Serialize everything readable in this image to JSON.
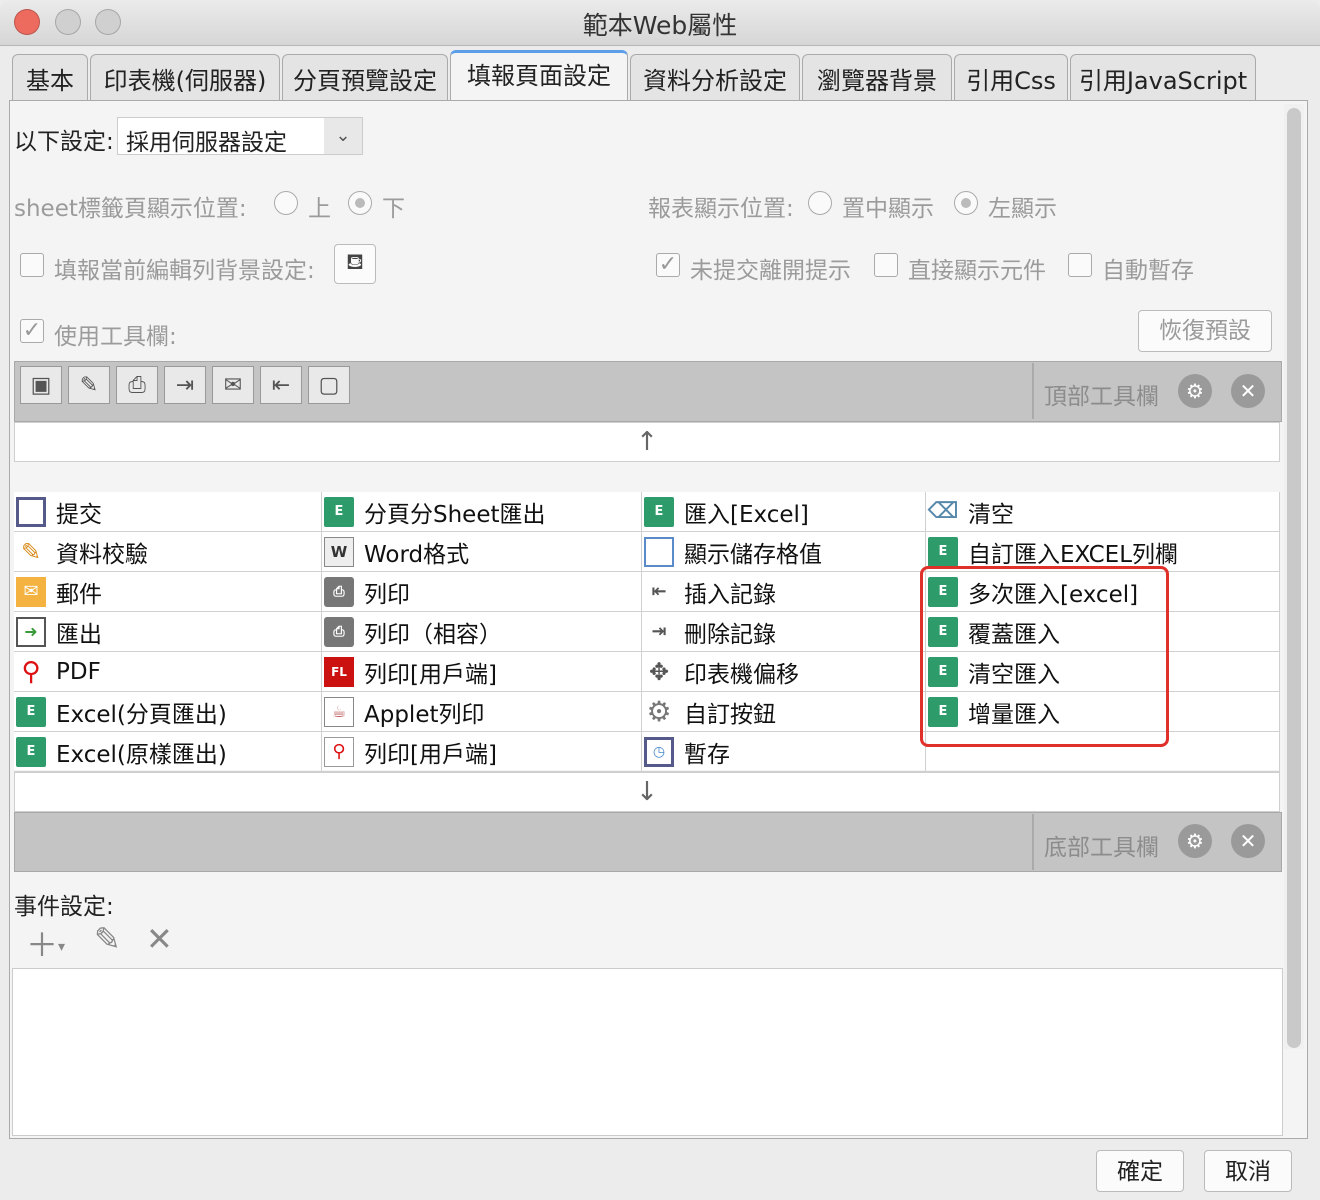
{
  "window": {
    "title": "範本Web屬性"
  },
  "tabs": [
    "基本",
    "印表機(伺服器)",
    "分頁預覽設定",
    "填報頁面設定",
    "資料分析設定",
    "瀏覽器背景",
    "引用Css",
    "引用JavaScript"
  ],
  "active_tab": "填報頁面設定",
  "settings": {
    "mode_label": "以下設定:",
    "mode_value": "採用伺服器設定",
    "sheet_pos_label": "sheet標籤頁顯示位置:",
    "sheet_top": "上",
    "sheet_bottom": "下",
    "report_pos_label": "報表顯示位置:",
    "report_center": "置中顯示",
    "report_left": "左顯示",
    "row_bg_label": "填報當前編輯列背景設定:",
    "unsubmitted_label": "未提交離開提示",
    "show_widget_label": "直接顯示元件",
    "autosave_label": "自動暫存",
    "use_toolbar_label": "使用工具欄:",
    "restore_default": "恢復預設"
  },
  "top_toolbar": {
    "label": "頂部工具欄",
    "icons": [
      "save-icon",
      "pencil-icon",
      "print-icon",
      "export-icon",
      "mail-icon",
      "insert-icon",
      "blank-icon"
    ]
  },
  "bottom_toolbar": {
    "label": "底部工具欄"
  },
  "button_grid": {
    "col1": [
      "提交",
      "資料校驗",
      "郵件",
      "匯出",
      "PDF",
      "Excel(分頁匯出)",
      "Excel(原樣匯出)"
    ],
    "col2": [
      "分頁分Sheet匯出",
      "Word格式",
      "列印",
      "列印（相容）",
      "列印[用戶端]",
      "Applet列印",
      "列印[用戶端]"
    ],
    "col3": [
      "匯入[Excel]",
      "顯示儲存格值",
      "插入記錄",
      "刪除記錄",
      "印表機偏移",
      "自訂按鈕",
      "暫存"
    ],
    "col4": [
      "清空",
      "自訂匯入EXCEL列欄",
      "多次匯入[excel]",
      "覆蓋匯入",
      "清空匯入",
      "增量匯入",
      ""
    ]
  },
  "events": {
    "label": "事件設定:"
  },
  "footer": {
    "ok": "確定",
    "cancel": "取消"
  },
  "colors": {
    "highlight": "#e0302a",
    "excel_icon": "#2e9c6a",
    "active_tab_accent": "#5c9ee8"
  }
}
